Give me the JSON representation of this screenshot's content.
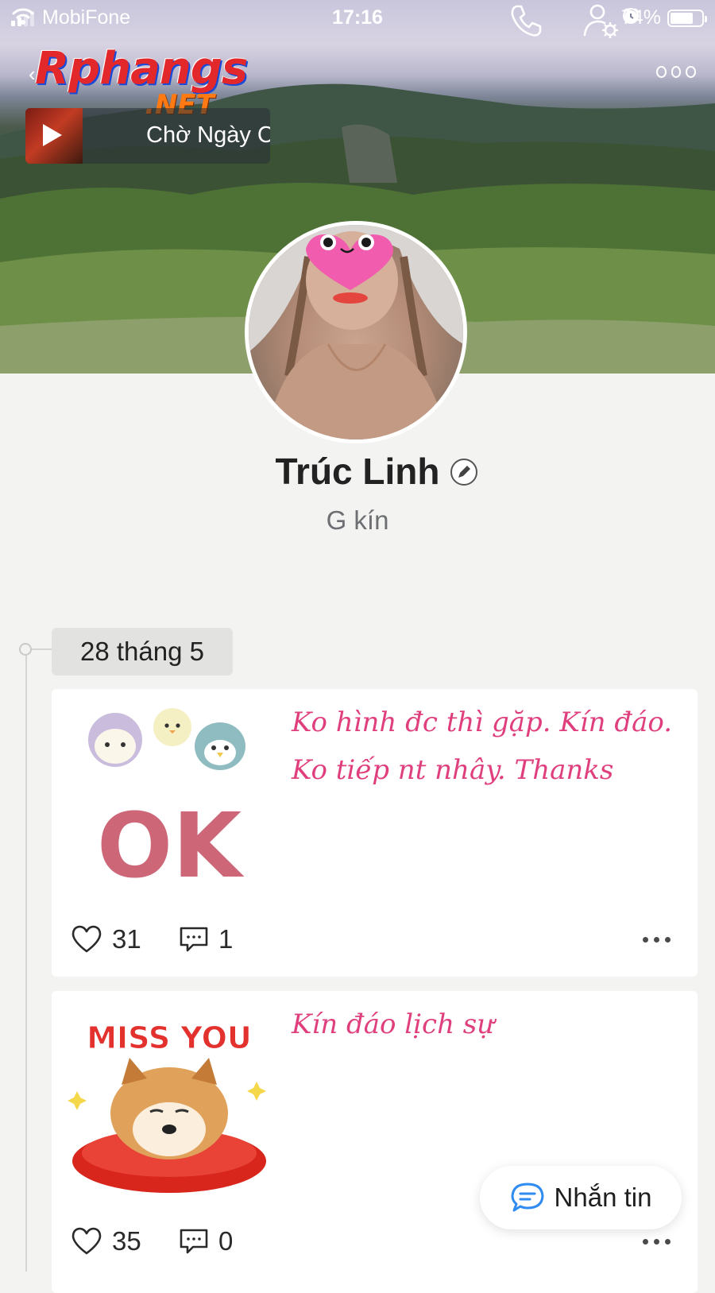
{
  "status_bar": {
    "carrier": "MobiFone",
    "time": "17:16",
    "battery": "74%",
    "battery_level": 0.74
  },
  "watermark": {
    "main": "Rphangs",
    "suffix": ".NET"
  },
  "header": {
    "icons": [
      "phone-icon",
      "user-settings-icon",
      "more-icon"
    ]
  },
  "music": {
    "title": "Chờ Ngày C"
  },
  "profile": {
    "name": "Trúc Linh",
    "bio": "G kín"
  },
  "timeline": {
    "date": "28 tháng 5"
  },
  "posts": [
    {
      "text": "Ko hình đc thì gặp. Kín đáo. Ko tiếp nt nhây. Thanks",
      "sticker_text": "OK",
      "likes": "31",
      "comments": "1"
    },
    {
      "text": "Kín đáo lịch sự",
      "sticker_text": "MISS YOU",
      "likes": "35",
      "comments": "0"
    }
  ],
  "message_button": {
    "label": "Nhắn tin"
  },
  "colors": {
    "post_text": "#e03f7d",
    "accent_blue": "#2f8bf0",
    "background": "#f3f4f2"
  }
}
